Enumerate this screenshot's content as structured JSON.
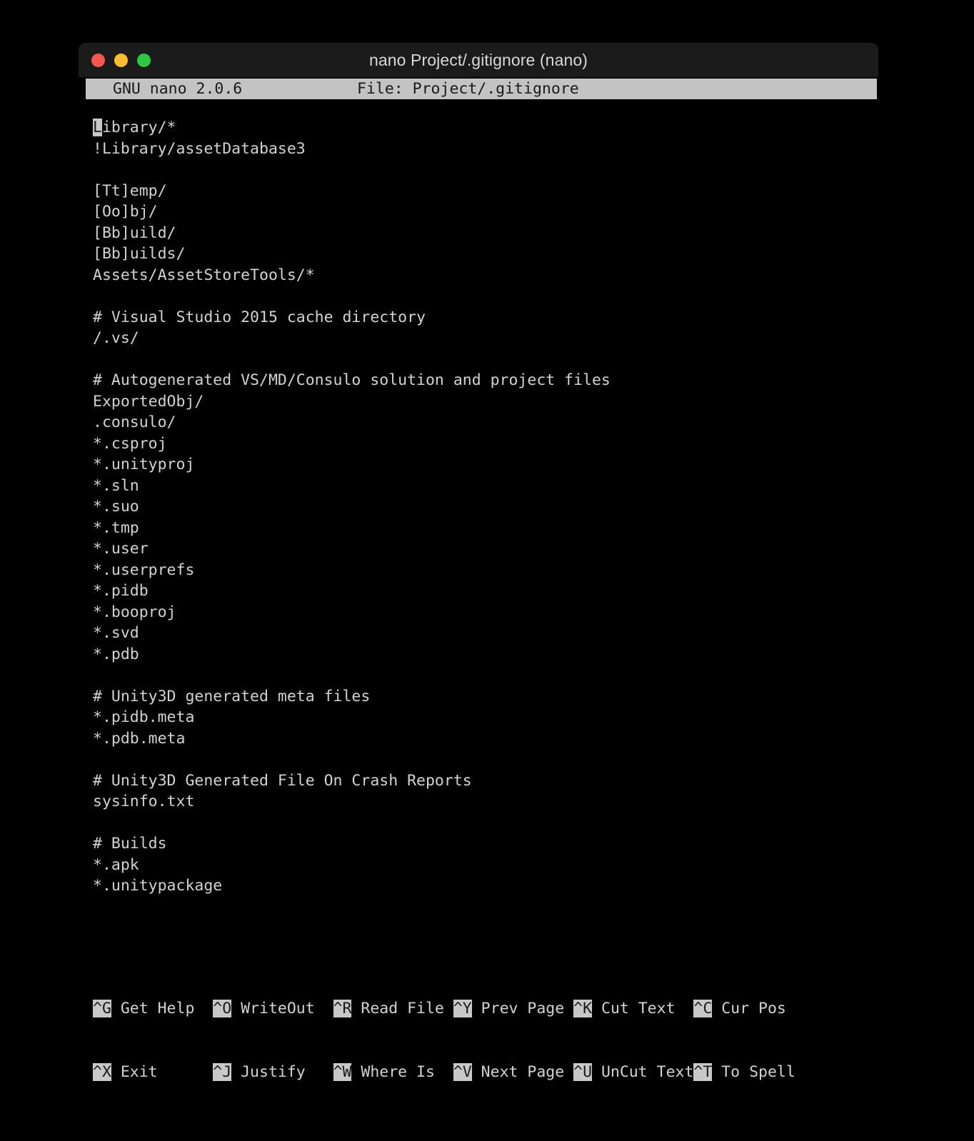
{
  "window": {
    "title": "nano Project/.gitignore (nano)",
    "traffic_lights": [
      {
        "name": "close",
        "color": "#f9564f"
      },
      {
        "name": "minimize",
        "color": "#fbbc2e"
      },
      {
        "name": "maximize",
        "color": "#2fc940"
      }
    ]
  },
  "nano": {
    "version_label": "GNU nano 2.0.6",
    "file_label": "File: Project/.gitignore",
    "cursor": {
      "line": 1,
      "column": 1,
      "char": "L"
    }
  },
  "editor": {
    "lines": [
      "Library/*",
      "!Library/assetDatabase3",
      "",
      "[Tt]emp/",
      "[Oo]bj/",
      "[Bb]uild/",
      "[Bb]uilds/",
      "Assets/AssetStoreTools/*",
      "",
      "# Visual Studio 2015 cache directory",
      "/.vs/",
      "",
      "# Autogenerated VS/MD/Consulo solution and project files",
      "ExportedObj/",
      ".consulo/",
      "*.csproj",
      "*.unityproj",
      "*.sln",
      "*.suo",
      "*.tmp",
      "*.user",
      "*.userprefs",
      "*.pidb",
      "*.booproj",
      "*.svd",
      "*.pdb",
      "",
      "# Unity3D generated meta files",
      "*.pidb.meta",
      "*.pdb.meta",
      "",
      "# Unity3D Generated File On Crash Reports",
      "sysinfo.txt",
      "",
      "# Builds",
      "*.apk",
      "*.unitypackage"
    ],
    "first_line_head": "L",
    "first_line_tail": "ibrary/*"
  },
  "helpbar": {
    "row1": [
      {
        "key": "^G",
        "label": " Get Help  "
      },
      {
        "key": "^O",
        "label": " WriteOut  "
      },
      {
        "key": "^R",
        "label": " Read File "
      },
      {
        "key": "^Y",
        "label": " Prev Page "
      },
      {
        "key": "^K",
        "label": " Cut Text  "
      },
      {
        "key": "^C",
        "label": " Cur Pos"
      }
    ],
    "row2": [
      {
        "key": "^X",
        "label": " Exit      "
      },
      {
        "key": "^J",
        "label": " Justify   "
      },
      {
        "key": "^W",
        "label": " Where Is  "
      },
      {
        "key": "^V",
        "label": " Next Page "
      },
      {
        "key": "^U",
        "label": " UnCut Text"
      },
      {
        "key": "^T",
        "label": " To Spell"
      }
    ]
  }
}
